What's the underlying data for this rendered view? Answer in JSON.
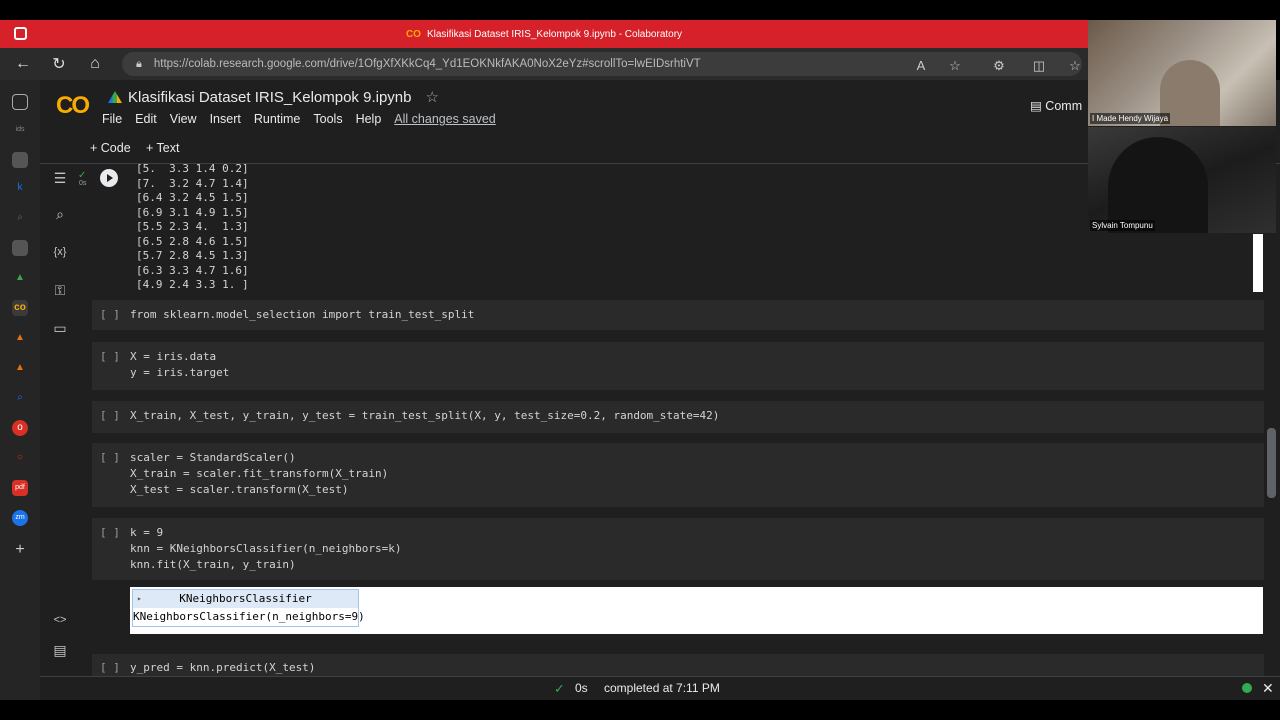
{
  "browser": {
    "window_title": "Klasifikasi Dataset IRIS_Kelompok 9.ipynb - Colaboratory",
    "url": "https://colab.research.google.com/drive/1OfgXfXKkCq4_Yd1EOKNkfAKA0NoX2eYz#scrollTo=lwEIDsrhtiVT"
  },
  "colab": {
    "logo": "CO",
    "notebook_title": "Klasifikasi Dataset IRIS_Kelompok 9.ipynb",
    "menu": [
      "File",
      "Edit",
      "View",
      "Insert",
      "Runtime",
      "Tools",
      "Help"
    ],
    "saved_status": "All changes saved",
    "comment_label": "Comm",
    "add_code": "+ Code",
    "add_text": "+ Text",
    "exec_time": "0s"
  },
  "output_lines": "[5.  3.3 1.4 0.2]\n[7.  3.2 4.7 1.4]\n[6.4 3.2 4.5 1.5]\n[6.9 3.1 4.9 1.5]\n[5.5 2.3 4.  1.3]\n[6.5 2.8 4.6 1.5]\n[5.7 2.8 4.5 1.3]\n[6.3 3.3 4.7 1.6]\n[4.9 2.4 3.3 1. ]",
  "cells": {
    "c1": "from sklearn.model_selection import train_test_split",
    "c2_l1": "X = iris.data",
    "c2_l2": "y = iris.target",
    "c3": "X_train, X_test, y_train, y_test = train_test_split(X, y, test_size=0.2, random_state=42)",
    "c4_l1": "scaler = StandardScaler()",
    "c4_l2": "X_train = scaler.fit_transform(X_train)",
    "c4_l3": "X_test = scaler.transform(X_test)",
    "c5_l1": "k = 9",
    "c5_l2": "knn = KNeighborsClassifier(n_neighbors=k)",
    "c5_l3": "knn.fit(X_train, y_train)",
    "c6": "y_pred = knn.predict(X_test)",
    "bracket": "[ ]"
  },
  "knn_output": {
    "header": "KNeighborsClassifier",
    "body": "KNeighborsClassifier(n_neighbors=9)"
  },
  "status": {
    "time": "0s",
    "message": "completed at 7:11 PM"
  },
  "participants": [
    "I Made Hendy Wijaya",
    "Sylvain Tompunu"
  ]
}
